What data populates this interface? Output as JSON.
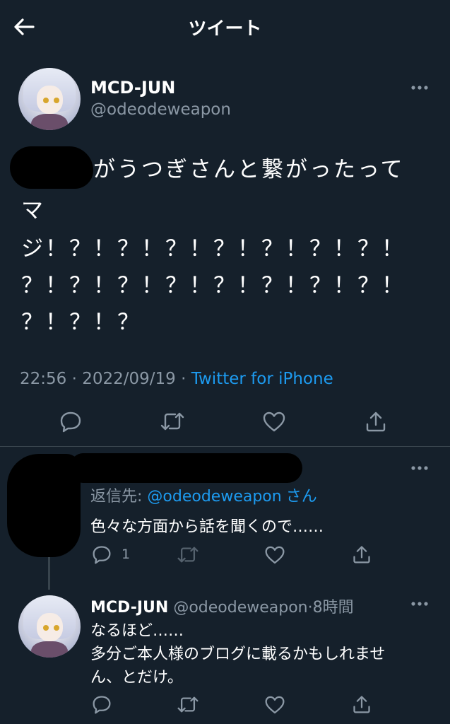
{
  "header": {
    "back_icon": "arrow-left-icon",
    "title": "ツイート"
  },
  "main_tweet": {
    "display_name": "MCD-JUN",
    "handle": "@odeodeweapon",
    "text_line1": "がうつぎさんと繋がったって",
    "text_line2": "マ",
    "text_line3": "ジ！？！？！？！？！？！？！？！",
    "text_line4": "？！？！？！？！？！？！？！？！",
    "text_line5": "？！？！？",
    "time": "22:56",
    "date": "2022/09/19",
    "source": "Twitter for iPhone",
    "actions": [
      "reply-icon",
      "retweet-icon",
      "like-icon",
      "share-icon"
    ]
  },
  "reply1": {
    "reply_to_prefix": "返信先: ",
    "reply_to_handle": "@odeodeweapon",
    "reply_to_suffix": "さん",
    "text": "色々な方面から話を聞くので……",
    "reply_count": "1"
  },
  "reply2": {
    "display_name": "MCD-JUN",
    "handle": "@odeodeweapon",
    "time_ago": "8時間",
    "text_line1": "なるほど……",
    "text_line2": "多分ご本人様のブログに載るかもしれませ",
    "text_line3": "ん、とだけ。"
  },
  "colors": {
    "background": "#15202b",
    "muted": "#8b98a5",
    "link": "#1d9bf0",
    "divider": "#38444d"
  }
}
